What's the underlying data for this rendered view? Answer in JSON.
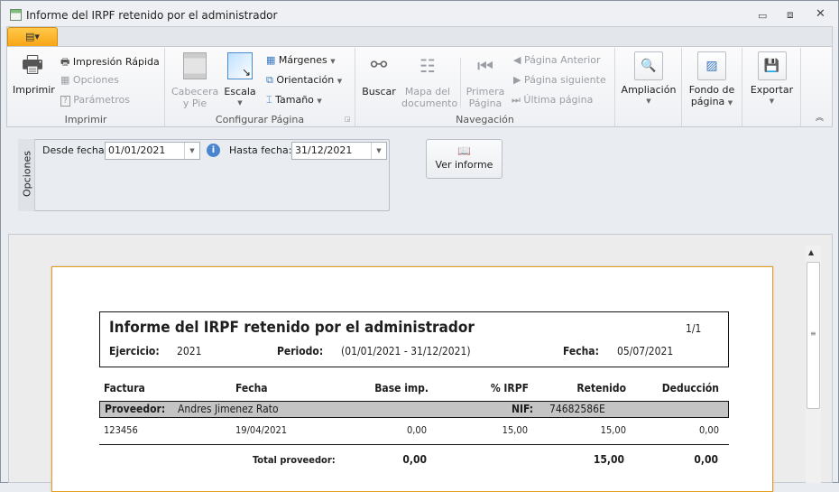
{
  "window": {
    "title": "Informe del IRPF retenido por el administrador"
  },
  "ribbon": {
    "imprimir_group": {
      "label": "Imprimir",
      "imprimir": "Imprimir",
      "impresion_rapida": "Impresión Rápida",
      "opciones": "Opciones",
      "parametros": "Parámetros"
    },
    "configurar_group": {
      "label": "Configurar Página",
      "cabecera": "Cabecera",
      "cabecera2": "y Pie",
      "escala": "Escala",
      "margenes": "Márgenes",
      "orientacion": "Orientación",
      "tamano": "Tamaño"
    },
    "navegacion_group": {
      "label": "Navegación",
      "buscar": "Buscar",
      "mapa1": "Mapa del",
      "mapa2": "documento",
      "primera1": "Primera",
      "primera2": "Página",
      "anterior": "Página Anterior",
      "siguiente": "Página siguiente",
      "ultima": "Última página"
    },
    "ampliacion": "Ampliación",
    "fondo1": "Fondo de",
    "fondo2": "página",
    "exportar": "Exportar"
  },
  "options": {
    "tab_label": "Opciones",
    "desde_label": "Desde fecha:",
    "desde_value": "01/01/2021",
    "hasta_label": "Hasta fecha:",
    "hasta_value": "31/12/2021",
    "ver_informe": "Ver informe"
  },
  "report": {
    "title": "Informe del IRPF retenido por el administrador",
    "page": "1/1",
    "ejercicio_label": "Ejercicio:",
    "ejercicio": "2021",
    "periodo_label": "Periodo:",
    "periodo": "(01/01/2021 - 31/12/2021)",
    "fecha_label": "Fecha:",
    "fecha": "05/07/2021",
    "columns": [
      "Factura",
      "Fecha",
      "Base imp.",
      "% IRPF",
      "Retenido",
      "Deducción"
    ],
    "proveedor_label": "Proveedor:",
    "proveedor": "Andres Jimenez Rato",
    "nif_label": "NIF:",
    "nif": "74682586E",
    "rows": [
      [
        "123456",
        "19/04/2021",
        "0,00",
        "15,00",
        "15,00",
        "0,00"
      ]
    ],
    "total_label": "Total proveedor:",
    "total_base": "0,00",
    "total_retenido": "15,00",
    "total_deduccion": "0,00"
  }
}
